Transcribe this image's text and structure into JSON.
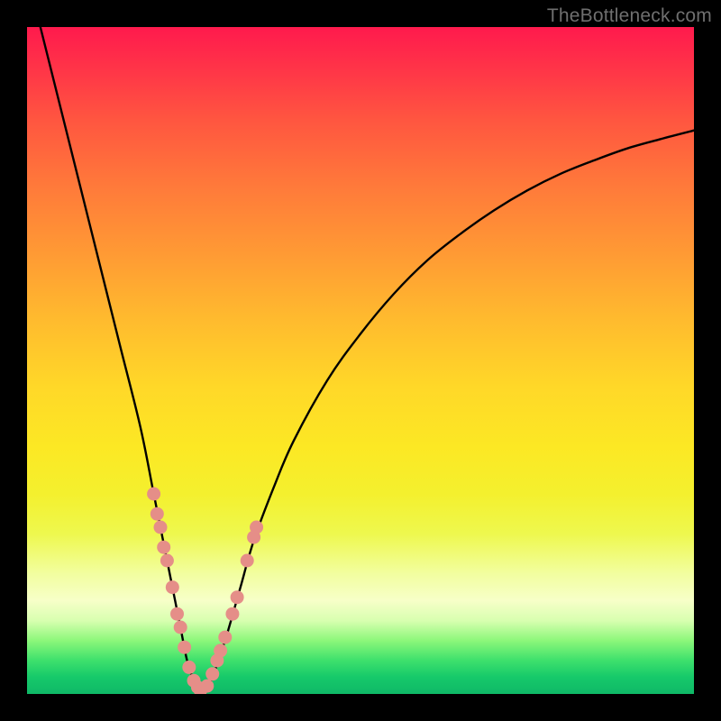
{
  "watermark": "TheBottleneck.com",
  "colors": {
    "frame": "#000000",
    "curve": "#000000",
    "dot_fill": "#e58e88",
    "dot_stroke": "#c96c66"
  },
  "chart_data": {
    "type": "line",
    "title": "",
    "xlabel": "",
    "ylabel": "",
    "xlim": [
      0,
      100
    ],
    "ylim": [
      0,
      100
    ],
    "note": "Bottleneck-style V-curve. y≈0 at the optimum near x≈26; rises steeply toward x→0 and more gradually toward x→100. No axes/ticks are shown; values are read from the plotted curve relative to the gradient rectangle.",
    "x": [
      2,
      5,
      8,
      11,
      14,
      17,
      19,
      21,
      23,
      24,
      25,
      26,
      27,
      28,
      29,
      30,
      32,
      34,
      37,
      40,
      45,
      50,
      55,
      60,
      65,
      70,
      75,
      80,
      85,
      90,
      95,
      100
    ],
    "y": [
      100,
      88,
      76,
      64,
      52,
      40,
      30,
      20,
      10,
      5,
      2,
      0,
      1,
      3,
      6,
      9,
      16,
      23,
      31,
      38,
      47,
      54,
      60,
      65,
      69,
      72.5,
      75.5,
      78,
      80,
      81.8,
      83.2,
      84.5
    ],
    "optimum_x": 26,
    "dots_left": [
      {
        "x": 19,
        "y": 30
      },
      {
        "x": 19.5,
        "y": 27
      },
      {
        "x": 20,
        "y": 25
      },
      {
        "x": 20.5,
        "y": 22
      },
      {
        "x": 21,
        "y": 20
      },
      {
        "x": 21.8,
        "y": 16
      },
      {
        "x": 22.5,
        "y": 12
      },
      {
        "x": 23,
        "y": 10
      },
      {
        "x": 23.6,
        "y": 7
      },
      {
        "x": 24.3,
        "y": 4
      },
      {
        "x": 25,
        "y": 2
      },
      {
        "x": 25.6,
        "y": 1
      },
      {
        "x": 26,
        "y": 0.5
      }
    ],
    "dots_right": [
      {
        "x": 27,
        "y": 1.2
      },
      {
        "x": 27.8,
        "y": 3
      },
      {
        "x": 28.5,
        "y": 5
      },
      {
        "x": 29,
        "y": 6.5
      },
      {
        "x": 29.7,
        "y": 8.5
      },
      {
        "x": 30.8,
        "y": 12
      },
      {
        "x": 31.5,
        "y": 14.5
      },
      {
        "x": 33,
        "y": 20
      },
      {
        "x": 34,
        "y": 23.5
      },
      {
        "x": 34.4,
        "y": 25
      }
    ]
  }
}
